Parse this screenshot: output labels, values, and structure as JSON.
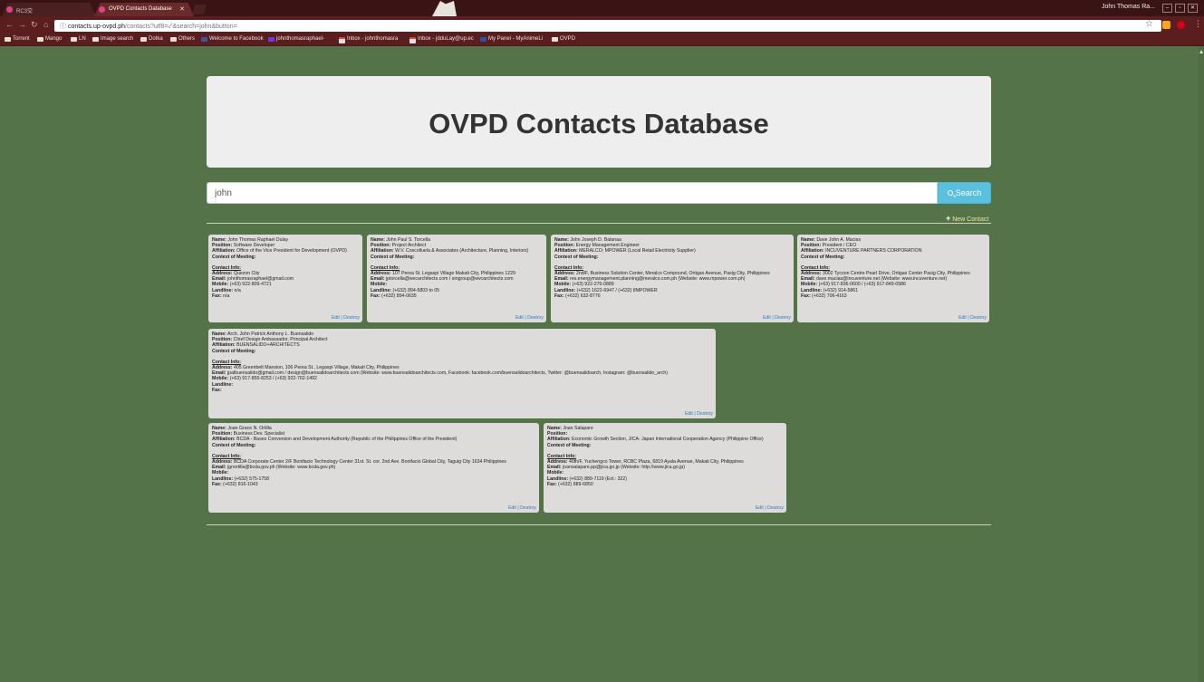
{
  "browser": {
    "tabs": [
      {
        "label": "RC3交"
      },
      {
        "label": "OVPD Contacts Database"
      }
    ],
    "user_name": "John Thomas Ra...",
    "url_host": "contacts.up-ovpd.ph",
    "url_path": "/contacts?utf8=✓&search=john&button=",
    "bookmarks": [
      "Torrent",
      "Mango",
      "LN",
      "Image search",
      "Dotka",
      "Others",
      "Welcome to Facebook",
      "johnthomasraphael-",
      "Inbox - johnthomasra",
      "Inbox - jdduLay@up.ec",
      "My Panel - MyAnimeLi",
      "OVPD"
    ]
  },
  "page": {
    "title": "OVPD Contacts Database",
    "search_value": "john",
    "search_button": "Search",
    "new_contact": "New Contact",
    "edit_label": "Edit",
    "sep": " | ",
    "destroy_label": "Destroy"
  },
  "labels": {
    "name": "Name:",
    "position": "Position:",
    "affiliation": "Affiliation:",
    "context": "Context of Meeting:",
    "contact_info": "Contact Info:",
    "address": "Address:",
    "email": "Email:",
    "mobile": "Mobile:",
    "landline": "Landline:",
    "fax": "Fax:"
  },
  "contacts": [
    {
      "name": "John Thomas Raphael Dulay",
      "position": "Software Developer",
      "affiliation": "Office of the Vice President for Development (OVPD)",
      "context": "",
      "address": "Quezon City",
      "email": "johnthomasraphael@gmail.com",
      "mobile": "(+63) 922-809-4721",
      "landline": "n/a",
      "fax": "n/a"
    },
    {
      "name": "John Paul S. Torcella",
      "position": "Project Architect",
      "affiliation": "W.V. Coscolluela & Associates (Architecture, Planning, Interiors)",
      "context": "",
      "address": "107 Perea St. Legaspi Village Makati City, Philippines 1229",
      "email": "jptorcella@wvcarchitects.com / smgroup@wvcarchitects.com",
      "mobile": "",
      "landline": "(+632) 894-5803 to 05",
      "fax": "(+632) 894-0635"
    },
    {
      "name": "John Joseph D. Balanaa",
      "position": "Energy Management Engineer",
      "affiliation": "MERALCO; MPOWER (Local Retail Electricity Supplier)",
      "context": "",
      "address": "2nd/F, Business Solution Center, Meralco Compound, Ortigas Avenue, Pasig City, Philippines",
      "email": "res.energymanagement.planning@meralco.com.ph (Website: www.mpower.com.ph)",
      "mobile": "(+63) 922-276-0889",
      "landline": "(+632) 1622-6947 / (+632) 8MPOWER",
      "fax": "(+632) 632-8776"
    },
    {
      "name": "Dave John A. Macias",
      "position": "President / CEO",
      "affiliation": "INCUVENTURE PARTNERS CORPORATION",
      "context": "",
      "address": "3002 Tycoon Centre Pearl Drive, Ortigas Center Pasig City, Philippines",
      "email": "dave.macias@incuventure.net (Website: www.incuventure.net)",
      "mobile": "(+63) 917-836-0600 / (+63) 917-849-0986",
      "landline": "(+632) 914-5861",
      "fax": "(+632) 706-4163"
    },
    {
      "name": "Arch. John Patrick Anthony L. Buensalido",
      "position": "Chief Design Ambassador, Principal Architect",
      "affiliation": "BUENSALIDO+ARCHITECTS",
      "context": "",
      "address": "405 Greenbelt Mansion, 106 Perea St., Legaspi Village, Makati City, Philippines",
      "email": "jpalbuensalido@gmail.com / design@buensalidoarchitects.com (Website: www.buensalidoarchitects.com, Facebook: facebook.com/buensalidoarchitects, Twitter: @buensalidoarch, Instagram: @buensalido_arch)",
      "mobile": "(+63) 917-855-8253 / (+63) 922-762-1492",
      "landline": "",
      "fax": ""
    },
    {
      "name": "Joan Grace N. Ortilla",
      "position": "Business Dev. Specialist",
      "affiliation": "BCDA - Bases Conversion and Development Authority (Republic of the Philippines Office of the President)",
      "context": "",
      "address": "BCDA Corporate Center 2/F Bonifacio Technology Center 31st. St. cor. 2nd Ave. Bonifacio Global City, Taguig City 1634 Philippines",
      "email": "jgnortilla@bcda.gov.ph (Website: www.bcda.gov.ph)",
      "mobile": "",
      "landline": "(+632) 575-1758",
      "fax": "(+632) 816-1043"
    },
    {
      "name": "Joan Salapare",
      "position": "",
      "affiliation": "Economic Growth Section, JICA- Japan International Cooperation Agency (Philippine Office)",
      "context": "",
      "address": "40th/F, Yuchengco Tower, RCBC Plaza, 6819 Ayala Avenue, Makati City, Philippines",
      "email": "joansalapare.pp@jica.go.jp (Website: http://www.jica.go.jp)",
      "mobile": "",
      "landline": "(+632) 889-7119 (Ext.: 322)",
      "fax": "(+632) 889-6850"
    }
  ]
}
